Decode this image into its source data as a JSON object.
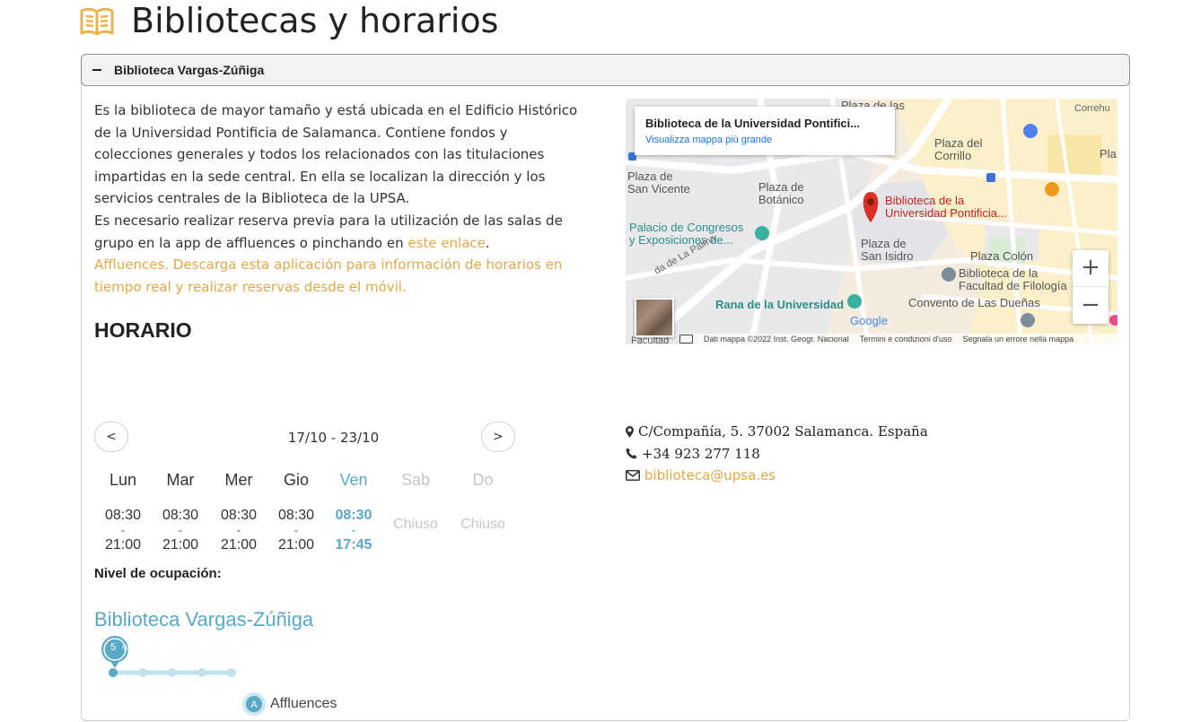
{
  "page": {
    "title": "Bibliotecas y horarios"
  },
  "panel": {
    "title": "Biblioteca Vargas-Zúñiga",
    "description_p1": "Es la biblioteca de mayor tamaño y está ubicada en el Edificio Histórico de la Universidad Pontificia de Salamanca. Contiene fondos y colecciones generales y todos los relacionados con las titulaciones impartidas en la sede central. En ella se localizan la dirección y los servicios centrales de la Biblioteca de la UPSA.",
    "description_p2": "Es necesario realizar reserva previa para la utilización de las salas de grupo en la app de affluences o pinchando en ",
    "link_text": "este enlace",
    "period": ".",
    "affluences_text": "Affluences. Descarga esta aplicación para información de horarios en tiempo real y realizar reservas desde el móvil.",
    "horario_heading": "HORARIO"
  },
  "map": {
    "card_title": "Biblioteca de la Universidad Pontifici...",
    "card_link": "Visualizza mappa più grande",
    "labels": {
      "plaza_san_vicente": "Plaza de\nSan Vicente",
      "plaza_botanico": "Plaza de\nBotánico",
      "palacio": "Palacio de Congresos\ny Exposiciones de...",
      "plaza_corrillo": "Plaza del\nCorrillo",
      "pin_label": "Biblioteca de la\nUniversidad Pontificia...",
      "plaza_san_isidro": "Plaza de\nSan Isidro",
      "plaza_colon": "Plaza Colón",
      "bib_filologia": "Biblioteca de la\nFacultad de Filología",
      "convento": "Convento de Las Dueñas",
      "rana": "Rana de la Universidad",
      "palma": "da de La Palma",
      "plaza_top": "Plaza de las",
      "correhu": "Correhu",
      "pla": "Pla",
      "google": "Google",
      "facultad": "Facultad"
    },
    "footer": {
      "data": "Dati mappa ©2022 Inst. Geogr. Nacional",
      "terms": "Termini e condizioni d'uso",
      "report": "Segnala un errore nella mappa"
    },
    "zoom_in": "+",
    "zoom_out": "−"
  },
  "contact": {
    "address": "C/Compañía, 5. 37002 Salamanca. España",
    "phone": "+34 923 277 118",
    "email": "biblioteca@upsa.es"
  },
  "schedule": {
    "prev": "<",
    "next": ">",
    "range": "17/10 - 23/10",
    "days": [
      {
        "name": "Lun",
        "open": "08:30",
        "dash": "-",
        "close": "21:00"
      },
      {
        "name": "Mar",
        "open": "08:30",
        "dash": "-",
        "close": "21:00"
      },
      {
        "name": "Mer",
        "open": "08:30",
        "dash": "-",
        "close": "21:00"
      },
      {
        "name": "Gio",
        "open": "08:30",
        "dash": "-",
        "close": "21:00"
      },
      {
        "name": "Ven",
        "open": "08:30",
        "dash": "-",
        "close": "17:45"
      },
      {
        "name": "Sab",
        "closed": "Chiuso"
      },
      {
        "name": "Do",
        "closed": "Chiuso"
      }
    ]
  },
  "occupancy": {
    "label": "Nivel de ocupación:",
    "library": "Biblioteca Vargas-Zúñiga",
    "value": "5",
    "unit": "%",
    "brand": "Affluences"
  },
  "colors": {
    "accent": "#e0a84a",
    "blue": "#5aa8c5",
    "map_bg": "#f3ecdf"
  }
}
